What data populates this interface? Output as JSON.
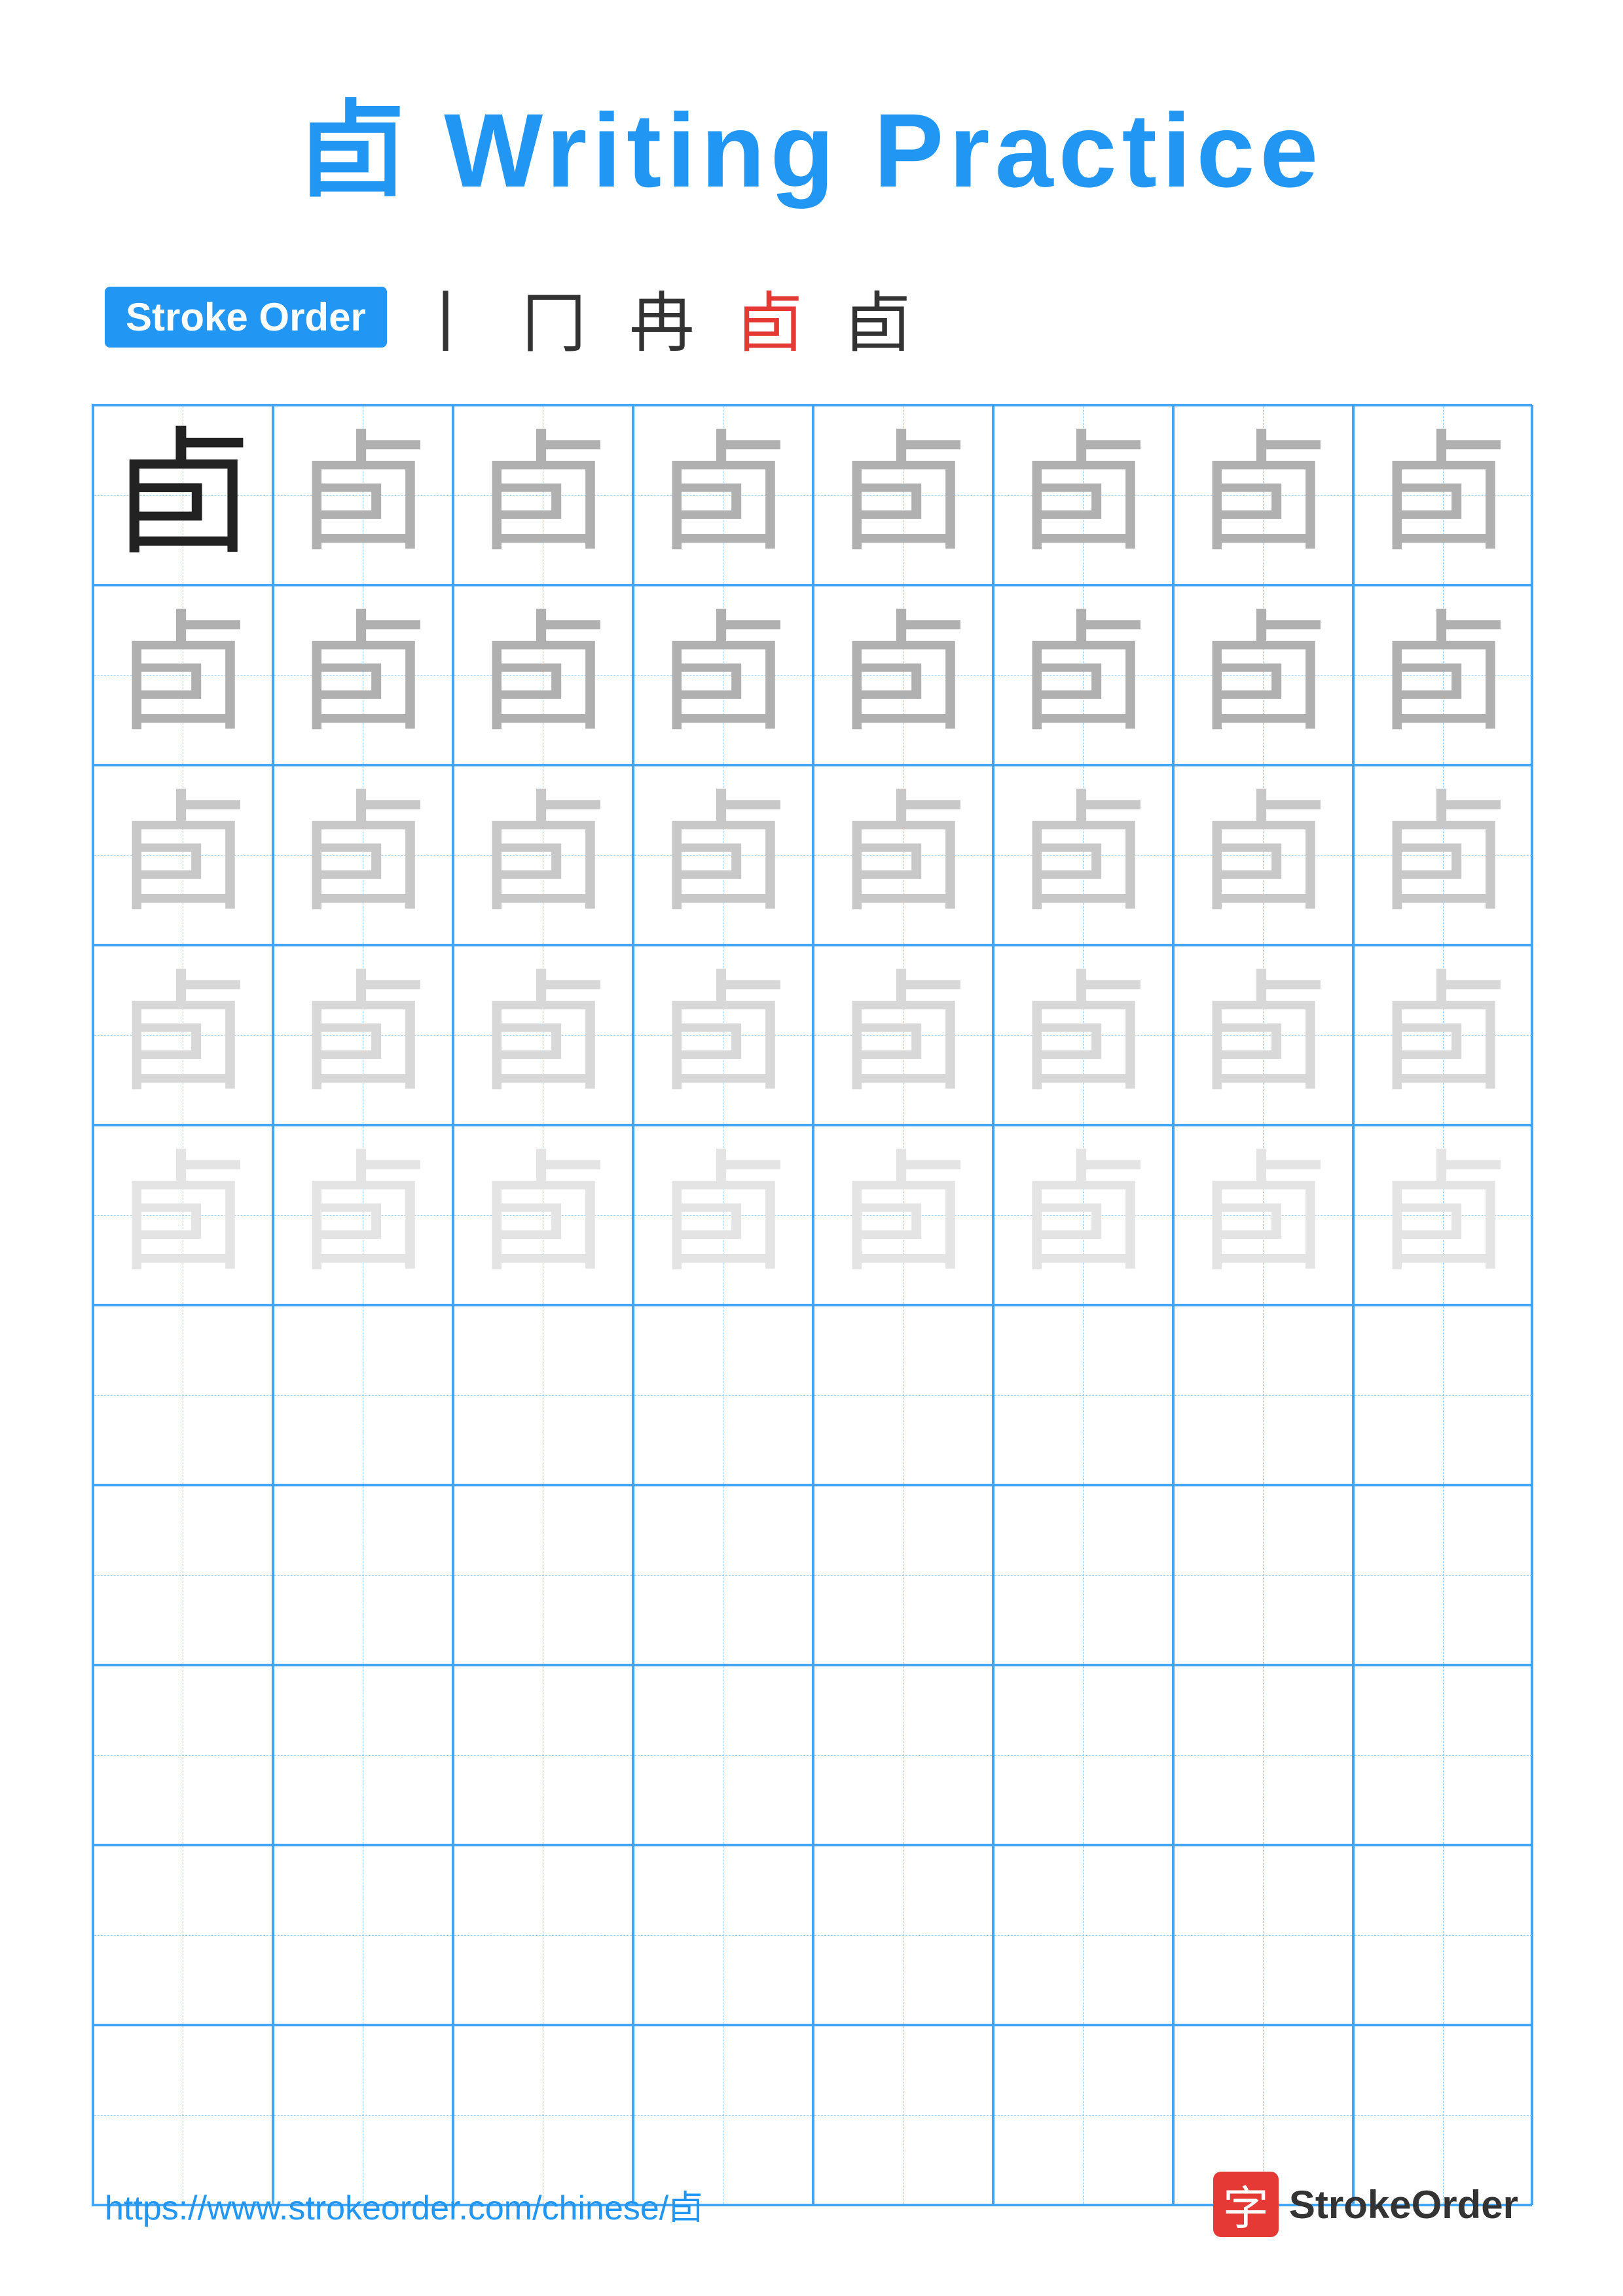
{
  "title": {
    "char": "卣",
    "text": "Writing Practice",
    "full": "卣 Writing Practice"
  },
  "stroke_order": {
    "badge_label": "Stroke Order",
    "strokes": "丨　冂　冉　卣"
  },
  "grid": {
    "rows": 10,
    "cols": 8,
    "char": "卣",
    "row_styles": [
      [
        "dark",
        "gray1",
        "gray1",
        "gray1",
        "gray1",
        "gray1",
        "gray1",
        "gray1"
      ],
      [
        "gray1",
        "gray1",
        "gray1",
        "gray1",
        "gray1",
        "gray1",
        "gray1",
        "gray1"
      ],
      [
        "gray2",
        "gray2",
        "gray2",
        "gray2",
        "gray2",
        "gray2",
        "gray2",
        "gray2"
      ],
      [
        "gray3",
        "gray3",
        "gray3",
        "gray3",
        "gray3",
        "gray3",
        "gray3",
        "gray3"
      ],
      [
        "gray4",
        "gray4",
        "gray4",
        "gray4",
        "gray4",
        "gray4",
        "gray4",
        "gray4"
      ],
      [
        "empty",
        "empty",
        "empty",
        "empty",
        "empty",
        "empty",
        "empty",
        "empty"
      ],
      [
        "empty",
        "empty",
        "empty",
        "empty",
        "empty",
        "empty",
        "empty",
        "empty"
      ],
      [
        "empty",
        "empty",
        "empty",
        "empty",
        "empty",
        "empty",
        "empty",
        "empty"
      ],
      [
        "empty",
        "empty",
        "empty",
        "empty",
        "empty",
        "empty",
        "empty",
        "empty"
      ],
      [
        "empty",
        "empty",
        "empty",
        "empty",
        "empty",
        "empty",
        "empty",
        "empty"
      ]
    ]
  },
  "footer": {
    "url": "https://www.strokeorder.com/chinese/卣",
    "logo_char": "字",
    "logo_text": "StrokeOrder"
  }
}
